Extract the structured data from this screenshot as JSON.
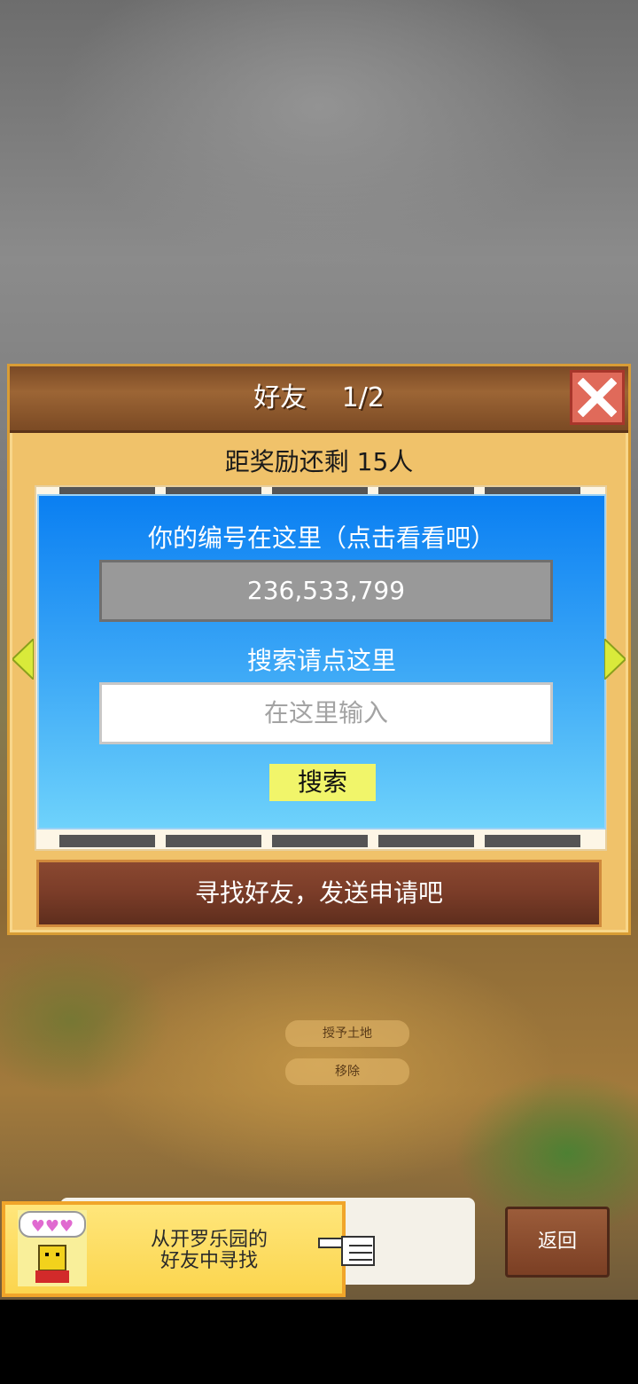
{
  "dialog": {
    "title": "好友　 1/2",
    "reward_text": "距奖励还剩 15人",
    "id_caption": "你的编号在这里（点击看看吧）",
    "id_value": "236,533,799",
    "search_caption": "搜索请点这里",
    "search_placeholder": "在这里输入",
    "search_button": "搜索",
    "find_friends": "寻找好友，发送申请吧"
  },
  "background_labels": {
    "grant_land": "授予土地",
    "remove": "移除"
  },
  "bottom": {
    "finder_line1": "从开罗乐园的",
    "finder_line2": "好友中寻找",
    "back": "返回"
  },
  "icons": {
    "close": "close-icon",
    "left": "chevron-left-icon",
    "right": "chevron-right-icon",
    "hand": "pointing-hand-icon",
    "avatar": "kairo-mascot-icon"
  },
  "colors": {
    "panel_blue": "#0a7ff2",
    "header_brown": "#7a4a26",
    "close_red": "#e06a5a",
    "search_yellow": "#f1f56a"
  }
}
